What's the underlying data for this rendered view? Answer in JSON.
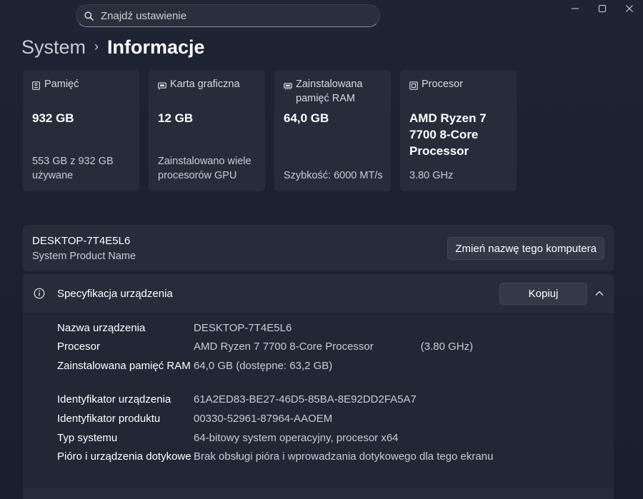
{
  "search": {
    "placeholder": "Znajdź ustawienie"
  },
  "breadcrumb": {
    "parent": "System",
    "separator": "›",
    "current": "Informacje"
  },
  "window_controls": {
    "minimize": "—",
    "maximize": "☐",
    "close": "✕"
  },
  "cards": [
    {
      "label": "Pamięć",
      "value": "932 GB",
      "sub": "553 GB z 932 GB używane"
    },
    {
      "label": "Karta graficzna",
      "value": "12 GB",
      "sub": "Zainstalowano wiele procesorów GPU"
    },
    {
      "label": "Zainstalowana pamięć RAM",
      "value": "64,0 GB",
      "sub": "Szybkość: 6000 MT/s"
    },
    {
      "label": "Procesor",
      "value": "AMD Ryzen 7 7700 8-Core Processor",
      "sub": "3.80 GHz"
    }
  ],
  "device": {
    "name": "DESKTOP-7T4E5L6",
    "model": "System Product Name",
    "rename_label": "Zmień nazwę tego komputera"
  },
  "spec": {
    "title": "Specyfikacja urządzenia",
    "copy_label": "Kopiuj",
    "rows": [
      {
        "key": "Nazwa urządzenia",
        "value": "DESKTOP-7T4E5L6"
      },
      {
        "key": "Procesor",
        "value": "AMD Ryzen 7 7700 8-Core Processor",
        "extra": "(3.80 GHz)"
      },
      {
        "key": "Zainstalowana pamięć RAM",
        "value": "64,0 GB (dostępne: 63,2 GB)"
      },
      {
        "key": "Identyfikator urządzenia",
        "value": "61A2ED83-BE27-46D5-85BA-8E92DD2FA5A7"
      },
      {
        "key": "Identyfikator produktu",
        "value": "00330-52961-87964-AAOEM"
      },
      {
        "key": "Typ systemu",
        "value": "64-bitowy system operacyjny, procesor x64"
      },
      {
        "key": "Pióro i urządzenia dotykowe",
        "value": "Brak obsługi pióra i wprowadzania dotykowego dla tego ekranu"
      }
    ]
  },
  "icons": {
    "search": "search-icon",
    "storage": "storage-icon",
    "gpu": "gpu-icon",
    "ram": "ram-icon",
    "cpu": "cpu-icon",
    "info": "info-icon",
    "collapse": "chevron-up-icon"
  },
  "colors": {
    "background": "#1c2130",
    "card": "#272c3b",
    "button": "#343948",
    "text_primary": "#ffffff",
    "text_secondary": "#c9cbd1"
  }
}
